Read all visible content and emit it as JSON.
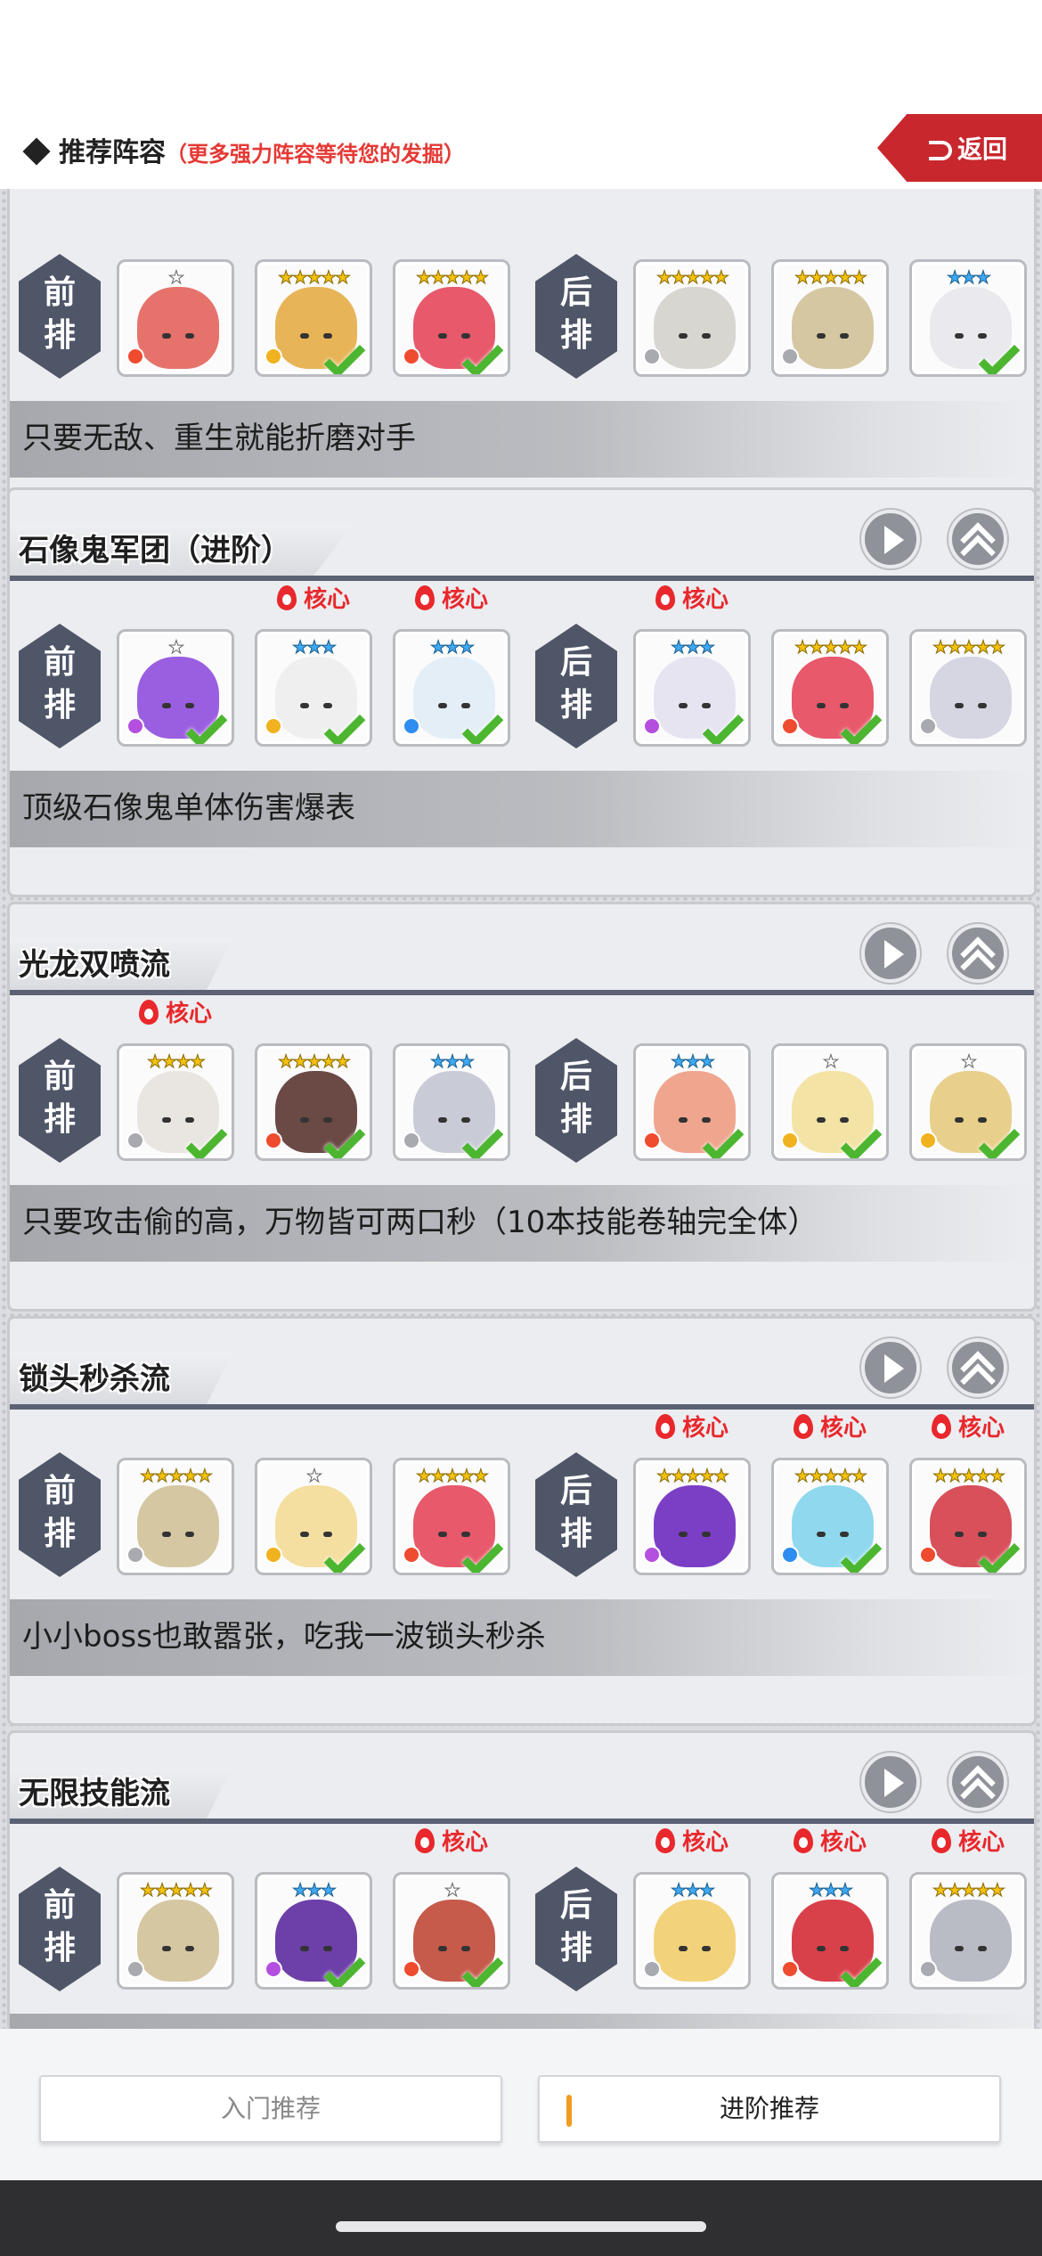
{
  "header": {
    "title": "推荐阵容",
    "subtitle": "（更多强力阵容等待您的发掘）",
    "back_label": "返回"
  },
  "labels": {
    "front": "前\n排",
    "front_a": "前",
    "front_b": "排",
    "back_a": "后",
    "back_b": "排",
    "core": "核心"
  },
  "cards": [
    {
      "name": "",
      "description": "只要无敌、重生就能折磨对手",
      "heroes": [
        {
          "stars": "★",
          "star_color": "silver",
          "color": "#e6736b",
          "element": "fire",
          "owned": false,
          "core": false
        },
        {
          "stars": "★★★★★",
          "star_color": "gold",
          "color": "#e7b457",
          "element": "wind",
          "owned": true,
          "core": false
        },
        {
          "stars": "★★★★★",
          "star_color": "gold",
          "color": "#e7596b",
          "element": "fire",
          "owned": true,
          "core": false
        },
        {
          "stars": "★★★★★",
          "star_color": "gold",
          "color": "#d8d6d0",
          "element": "light",
          "owned": false,
          "core": false
        },
        {
          "stars": "★★★★★",
          "star_color": "gold",
          "color": "#d6c7a3",
          "element": "light",
          "owned": false,
          "core": false
        },
        {
          "stars": "★★★",
          "star_color": "blue",
          "color": "#e9e9ee",
          "element": "none",
          "owned": true,
          "core": false
        }
      ]
    },
    {
      "name": "石像鬼军团（进阶）",
      "description": "顶级石像鬼单体伤害爆表",
      "heroes": [
        {
          "stars": "★",
          "star_color": "silver",
          "color": "#9a5fe0",
          "element": "dark",
          "owned": true,
          "core": false
        },
        {
          "stars": "★★★",
          "star_color": "blue",
          "color": "#efefef",
          "element": "wind",
          "owned": true,
          "core": true
        },
        {
          "stars": "★★★",
          "star_color": "blue",
          "color": "#e4eef6",
          "element": "water",
          "owned": true,
          "core": true
        },
        {
          "stars": "★★★",
          "star_color": "blue",
          "color": "#e7e4f2",
          "element": "dark",
          "owned": true,
          "core": true
        },
        {
          "stars": "★★★★★",
          "star_color": "gold",
          "color": "#e7596b",
          "element": "fire",
          "owned": true,
          "core": false
        },
        {
          "stars": "★★★★★",
          "star_color": "gold",
          "color": "#d5d6e2",
          "element": "light",
          "owned": false,
          "core": false
        }
      ]
    },
    {
      "name": "光龙双喷流",
      "description": "只要攻击偷的高，万物皆可两口秒（10本技能卷轴完全体）",
      "heroes": [
        {
          "stars": "★★★★",
          "star_color": "gold",
          "color": "#e9e6e1",
          "element": "light",
          "owned": true,
          "core": true
        },
        {
          "stars": "★★★★★",
          "star_color": "gold",
          "color": "#6b4a45",
          "element": "fire",
          "owned": true,
          "core": false
        },
        {
          "stars": "★★★",
          "star_color": "blue",
          "color": "#c9ccd6",
          "element": "light",
          "owned": true,
          "core": false
        },
        {
          "stars": "★★★",
          "star_color": "blue",
          "color": "#f0a58e",
          "element": "fire",
          "owned": true,
          "core": false
        },
        {
          "stars": "★",
          "star_color": "silver",
          "color": "#f3e3a4",
          "element": "wind",
          "owned": true,
          "core": false
        },
        {
          "stars": "★",
          "star_color": "silver",
          "color": "#e8cf8b",
          "element": "wind",
          "owned": true,
          "core": false
        }
      ]
    },
    {
      "name": "锁头秒杀流",
      "description": "小小boss也敢嚣张，吃我一波锁头秒杀",
      "heroes": [
        {
          "stars": "★★★★★",
          "star_color": "gold",
          "color": "#d6c7a3",
          "element": "light",
          "owned": false,
          "core": false
        },
        {
          "stars": "★",
          "star_color": "silver",
          "color": "#f4dfa1",
          "element": "wind",
          "owned": true,
          "core": false
        },
        {
          "stars": "★★★★★",
          "star_color": "gold",
          "color": "#e7596b",
          "element": "fire",
          "owned": true,
          "core": false
        },
        {
          "stars": "★★★★★",
          "star_color": "gold",
          "color": "#7b3fc6",
          "element": "dark",
          "owned": false,
          "core": true
        },
        {
          "stars": "★★★★★",
          "star_color": "gold",
          "color": "#8fd8ee",
          "element": "water",
          "owned": true,
          "core": true
        },
        {
          "stars": "★★★★★",
          "star_color": "gold",
          "color": "#d8505a",
          "element": "fire",
          "owned": true,
          "core": true
        }
      ]
    },
    {
      "name": "无限技能流",
      "description": "",
      "heroes": [
        {
          "stars": "★★★★★",
          "star_color": "gold",
          "color": "#d6c7a3",
          "element": "light",
          "owned": false,
          "core": false
        },
        {
          "stars": "★★★",
          "star_color": "blue",
          "color": "#6d3fa8",
          "element": "dark",
          "owned": true,
          "core": false
        },
        {
          "stars": "★",
          "star_color": "silver",
          "color": "#c65a4b",
          "element": "fire",
          "owned": true,
          "core": true
        },
        {
          "stars": "★★★",
          "star_color": "blue",
          "color": "#f2d27a",
          "element": "light",
          "owned": false,
          "core": true
        },
        {
          "stars": "★★★",
          "star_color": "blue",
          "color": "#d9414a",
          "element": "fire",
          "owned": true,
          "core": true
        },
        {
          "stars": "★★★★★",
          "star_color": "gold",
          "color": "#b9bcc4",
          "element": "light",
          "owned": false,
          "core": true
        }
      ]
    }
  ],
  "tabs": {
    "intro": "入门推荐",
    "advanced": "进阶推荐"
  },
  "element_colors": {
    "fire": "#ef4b2e",
    "wind": "#f0b21e",
    "water": "#2e8df0",
    "light": "#a8aab0",
    "dark": "#b44fe0"
  }
}
